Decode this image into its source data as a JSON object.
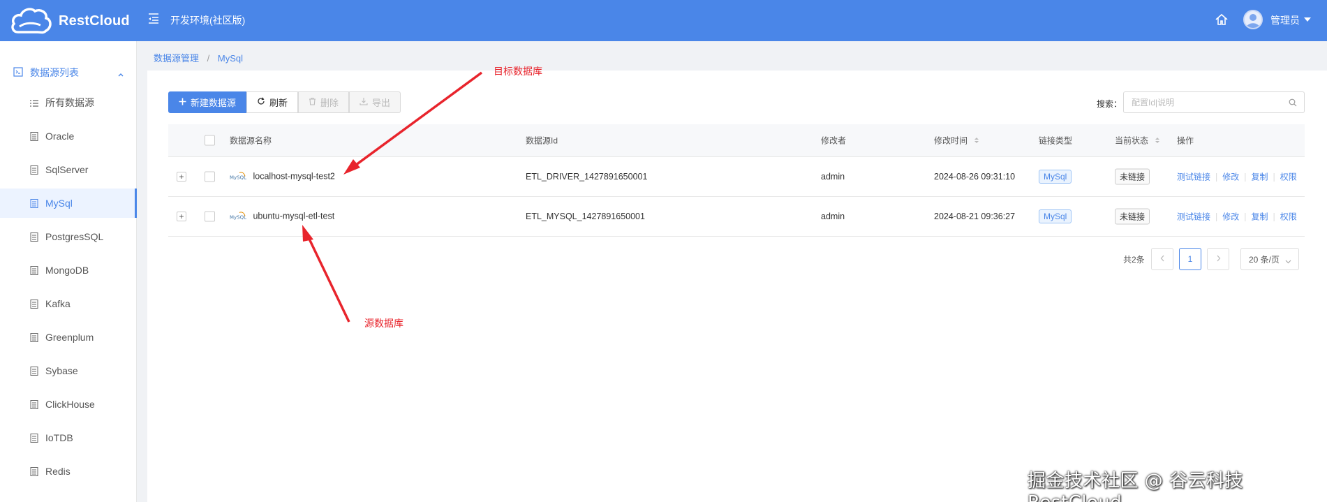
{
  "header": {
    "brand": "RestCloud",
    "env_title": "开发环境(社区版)",
    "user_name": "管理员"
  },
  "sidebar": {
    "group_label": "数据源列表",
    "items": [
      {
        "label": "所有数据源"
      },
      {
        "label": "Oracle"
      },
      {
        "label": "SqlServer"
      },
      {
        "label": "MySql",
        "active": true
      },
      {
        "label": "PostgresSQL"
      },
      {
        "label": "MongoDB"
      },
      {
        "label": "Kafka"
      },
      {
        "label": "Greenplum"
      },
      {
        "label": "Sybase"
      },
      {
        "label": "ClickHouse"
      },
      {
        "label": "IoTDB"
      },
      {
        "label": "Redis"
      }
    ]
  },
  "breadcrumb": {
    "root": "数据源管理",
    "sep": "/",
    "current": "MySql"
  },
  "toolbar": {
    "new_label": "新建数据源",
    "refresh_label": "刷新",
    "delete_label": "删除",
    "export_label": "导出"
  },
  "search": {
    "label": "搜索：",
    "placeholder": "配置Id|说明"
  },
  "table": {
    "columns": {
      "name": "数据源名称",
      "id": "数据源Id",
      "modifier": "修改者",
      "modified_time": "修改时间",
      "link_type": "链接类型",
      "status": "当前状态",
      "actions": "操作"
    },
    "rows": [
      {
        "name": "localhost-mysql-test2",
        "id": "ETL_DRIVER_1427891650001",
        "modifier": "admin",
        "modified_time": "2024-08-26 09:31:10",
        "link_type": "MySql",
        "status": "未链接"
      },
      {
        "name": "ubuntu-mysql-etl-test",
        "id": "ETL_MYSQL_1427891650001",
        "modifier": "admin",
        "modified_time": "2024-08-21 09:36:27",
        "link_type": "MySql",
        "status": "未链接"
      }
    ],
    "row_actions": [
      "测试链接",
      "修改",
      "复制",
      "权限"
    ],
    "expand_symbol": "+",
    "logo_text": "MySQL"
  },
  "pagination": {
    "total": "共2条",
    "current_page": "1",
    "page_size": "20 条/页"
  },
  "annotations": {
    "target_db": "目标数据库",
    "source_db": "源数据库"
  },
  "watermark": "掘金技术社区 @ 谷云科技RestCloud",
  "colors": {
    "primary": "#4a86e8",
    "annotation": "#e8242c"
  }
}
